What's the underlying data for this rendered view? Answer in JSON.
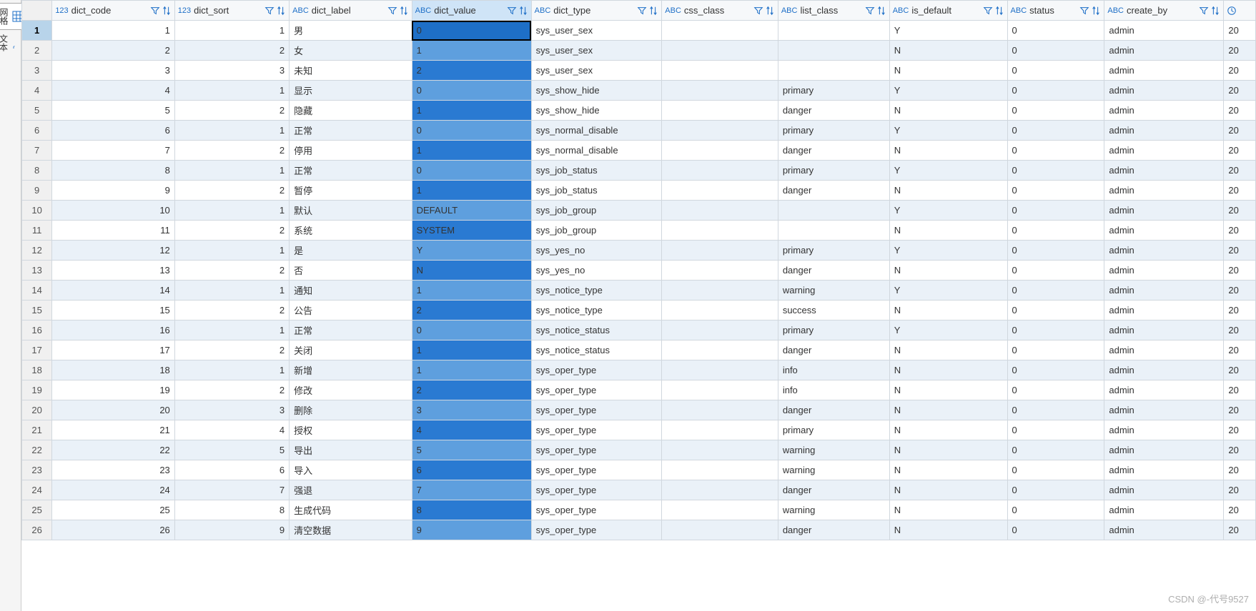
{
  "sidebar": {
    "tabs": [
      {
        "label": "网格",
        "icon": "grid-icon",
        "active": true
      },
      {
        "label": "文本",
        "icon": "text-icon",
        "active": false
      }
    ]
  },
  "columns": [
    {
      "name": "dict_code",
      "type": "123",
      "selected": false
    },
    {
      "name": "dict_sort",
      "type": "123",
      "selected": false
    },
    {
      "name": "dict_label",
      "type": "ABC",
      "selected": false
    },
    {
      "name": "dict_value",
      "type": "ABC",
      "selected": true
    },
    {
      "name": "dict_type",
      "type": "ABC",
      "selected": false
    },
    {
      "name": "css_class",
      "type": "ABC",
      "selected": false
    },
    {
      "name": "list_class",
      "type": "ABC",
      "selected": false
    },
    {
      "name": "is_default",
      "type": "ABC",
      "selected": false
    },
    {
      "name": "status",
      "type": "ABC",
      "selected": false
    },
    {
      "name": "create_by",
      "type": "ABC",
      "selected": false
    }
  ],
  "last_col_icon": "clock-icon",
  "selected_row": 1,
  "selected_col": 3,
  "rows": [
    {
      "n": 1,
      "dict_code": 1,
      "dict_sort": 1,
      "dict_label": "男",
      "dict_value": "0",
      "dict_type": "sys_user_sex",
      "css_class": "",
      "list_class": "",
      "is_default": "Y",
      "status": "0",
      "create_by": "admin",
      "extra": "20"
    },
    {
      "n": 2,
      "dict_code": 2,
      "dict_sort": 2,
      "dict_label": "女",
      "dict_value": "1",
      "dict_type": "sys_user_sex",
      "css_class": "",
      "list_class": "",
      "is_default": "N",
      "status": "0",
      "create_by": "admin",
      "extra": "20"
    },
    {
      "n": 3,
      "dict_code": 3,
      "dict_sort": 3,
      "dict_label": "未知",
      "dict_value": "2",
      "dict_type": "sys_user_sex",
      "css_class": "",
      "list_class": "",
      "is_default": "N",
      "status": "0",
      "create_by": "admin",
      "extra": "20"
    },
    {
      "n": 4,
      "dict_code": 4,
      "dict_sort": 1,
      "dict_label": "显示",
      "dict_value": "0",
      "dict_type": "sys_show_hide",
      "css_class": "",
      "list_class": "primary",
      "is_default": "Y",
      "status": "0",
      "create_by": "admin",
      "extra": "20"
    },
    {
      "n": 5,
      "dict_code": 5,
      "dict_sort": 2,
      "dict_label": "隐藏",
      "dict_value": "1",
      "dict_type": "sys_show_hide",
      "css_class": "",
      "list_class": "danger",
      "is_default": "N",
      "status": "0",
      "create_by": "admin",
      "extra": "20"
    },
    {
      "n": 6,
      "dict_code": 6,
      "dict_sort": 1,
      "dict_label": "正常",
      "dict_value": "0",
      "dict_type": "sys_normal_disable",
      "css_class": "",
      "list_class": "primary",
      "is_default": "Y",
      "status": "0",
      "create_by": "admin",
      "extra": "20"
    },
    {
      "n": 7,
      "dict_code": 7,
      "dict_sort": 2,
      "dict_label": "停用",
      "dict_value": "1",
      "dict_type": "sys_normal_disable",
      "css_class": "",
      "list_class": "danger",
      "is_default": "N",
      "status": "0",
      "create_by": "admin",
      "extra": "20"
    },
    {
      "n": 8,
      "dict_code": 8,
      "dict_sort": 1,
      "dict_label": "正常",
      "dict_value": "0",
      "dict_type": "sys_job_status",
      "css_class": "",
      "list_class": "primary",
      "is_default": "Y",
      "status": "0",
      "create_by": "admin",
      "extra": "20"
    },
    {
      "n": 9,
      "dict_code": 9,
      "dict_sort": 2,
      "dict_label": "暂停",
      "dict_value": "1",
      "dict_type": "sys_job_status",
      "css_class": "",
      "list_class": "danger",
      "is_default": "N",
      "status": "0",
      "create_by": "admin",
      "extra": "20"
    },
    {
      "n": 10,
      "dict_code": 10,
      "dict_sort": 1,
      "dict_label": "默认",
      "dict_value": "DEFAULT",
      "dict_type": "sys_job_group",
      "css_class": "",
      "list_class": "",
      "is_default": "Y",
      "status": "0",
      "create_by": "admin",
      "extra": "20"
    },
    {
      "n": 11,
      "dict_code": 11,
      "dict_sort": 2,
      "dict_label": "系统",
      "dict_value": "SYSTEM",
      "dict_type": "sys_job_group",
      "css_class": "",
      "list_class": "",
      "is_default": "N",
      "status": "0",
      "create_by": "admin",
      "extra": "20"
    },
    {
      "n": 12,
      "dict_code": 12,
      "dict_sort": 1,
      "dict_label": "是",
      "dict_value": "Y",
      "dict_type": "sys_yes_no",
      "css_class": "",
      "list_class": "primary",
      "is_default": "Y",
      "status": "0",
      "create_by": "admin",
      "extra": "20"
    },
    {
      "n": 13,
      "dict_code": 13,
      "dict_sort": 2,
      "dict_label": "否",
      "dict_value": "N",
      "dict_type": "sys_yes_no",
      "css_class": "",
      "list_class": "danger",
      "is_default": "N",
      "status": "0",
      "create_by": "admin",
      "extra": "20"
    },
    {
      "n": 14,
      "dict_code": 14,
      "dict_sort": 1,
      "dict_label": "通知",
      "dict_value": "1",
      "dict_type": "sys_notice_type",
      "css_class": "",
      "list_class": "warning",
      "is_default": "Y",
      "status": "0",
      "create_by": "admin",
      "extra": "20"
    },
    {
      "n": 15,
      "dict_code": 15,
      "dict_sort": 2,
      "dict_label": "公告",
      "dict_value": "2",
      "dict_type": "sys_notice_type",
      "css_class": "",
      "list_class": "success",
      "is_default": "N",
      "status": "0",
      "create_by": "admin",
      "extra": "20"
    },
    {
      "n": 16,
      "dict_code": 16,
      "dict_sort": 1,
      "dict_label": "正常",
      "dict_value": "0",
      "dict_type": "sys_notice_status",
      "css_class": "",
      "list_class": "primary",
      "is_default": "Y",
      "status": "0",
      "create_by": "admin",
      "extra": "20"
    },
    {
      "n": 17,
      "dict_code": 17,
      "dict_sort": 2,
      "dict_label": "关闭",
      "dict_value": "1",
      "dict_type": "sys_notice_status",
      "css_class": "",
      "list_class": "danger",
      "is_default": "N",
      "status": "0",
      "create_by": "admin",
      "extra": "20"
    },
    {
      "n": 18,
      "dict_code": 18,
      "dict_sort": 1,
      "dict_label": "新增",
      "dict_value": "1",
      "dict_type": "sys_oper_type",
      "css_class": "",
      "list_class": "info",
      "is_default": "N",
      "status": "0",
      "create_by": "admin",
      "extra": "20"
    },
    {
      "n": 19,
      "dict_code": 19,
      "dict_sort": 2,
      "dict_label": "修改",
      "dict_value": "2",
      "dict_type": "sys_oper_type",
      "css_class": "",
      "list_class": "info",
      "is_default": "N",
      "status": "0",
      "create_by": "admin",
      "extra": "20"
    },
    {
      "n": 20,
      "dict_code": 20,
      "dict_sort": 3,
      "dict_label": "删除",
      "dict_value": "3",
      "dict_type": "sys_oper_type",
      "css_class": "",
      "list_class": "danger",
      "is_default": "N",
      "status": "0",
      "create_by": "admin",
      "extra": "20"
    },
    {
      "n": 21,
      "dict_code": 21,
      "dict_sort": 4,
      "dict_label": "授权",
      "dict_value": "4",
      "dict_type": "sys_oper_type",
      "css_class": "",
      "list_class": "primary",
      "is_default": "N",
      "status": "0",
      "create_by": "admin",
      "extra": "20"
    },
    {
      "n": 22,
      "dict_code": 22,
      "dict_sort": 5,
      "dict_label": "导出",
      "dict_value": "5",
      "dict_type": "sys_oper_type",
      "css_class": "",
      "list_class": "warning",
      "is_default": "N",
      "status": "0",
      "create_by": "admin",
      "extra": "20"
    },
    {
      "n": 23,
      "dict_code": 23,
      "dict_sort": 6,
      "dict_label": "导入",
      "dict_value": "6",
      "dict_type": "sys_oper_type",
      "css_class": "",
      "list_class": "warning",
      "is_default": "N",
      "status": "0",
      "create_by": "admin",
      "extra": "20"
    },
    {
      "n": 24,
      "dict_code": 24,
      "dict_sort": 7,
      "dict_label": "强退",
      "dict_value": "7",
      "dict_type": "sys_oper_type",
      "css_class": "",
      "list_class": "danger",
      "is_default": "N",
      "status": "0",
      "create_by": "admin",
      "extra": "20"
    },
    {
      "n": 25,
      "dict_code": 25,
      "dict_sort": 8,
      "dict_label": "生成代码",
      "dict_value": "8",
      "dict_type": "sys_oper_type",
      "css_class": "",
      "list_class": "warning",
      "is_default": "N",
      "status": "0",
      "create_by": "admin",
      "extra": "20"
    },
    {
      "n": 26,
      "dict_code": 26,
      "dict_sort": 9,
      "dict_label": "清空数据",
      "dict_value": "9",
      "dict_type": "sys_oper_type",
      "css_class": "",
      "list_class": "danger",
      "is_default": "N",
      "status": "0",
      "create_by": "admin",
      "extra": "20"
    }
  ],
  "watermark": "CSDN @-代号9527"
}
